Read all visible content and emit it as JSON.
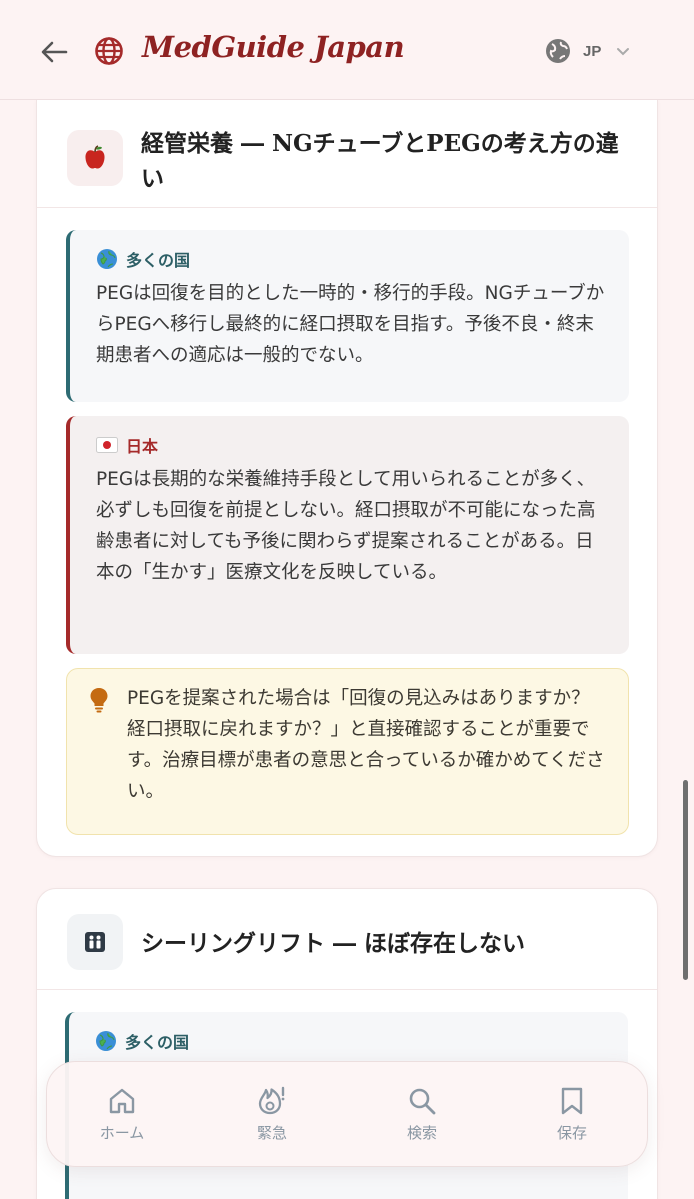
{
  "header": {
    "app_title": "MedGuide Japan",
    "lang_code": "JP"
  },
  "cards": [
    {
      "icon": "apple-icon",
      "title": "経管栄養 ― NGチューブとPEGの考え方の違い",
      "global_label": "多くの国",
      "global_text": "PEGは回復を目的とした一時的・移行的手段。NGチューブからPEGへ移行し最終的に経口摂取を目指す。予後不良・終末期患者への適応は一般的でない。",
      "japan_label": "日本",
      "japan_text": "PEGは長期的な栄養維持手段として用いられることが多く、必ずしも回復を前提としない。経口摂取が不可能になった高齢患者に対しても予後に関わらず提案されることがある。日本の「生かす」医療文化を反映している。",
      "tip_text": "PEGを提案された場合は「回復の見込みはありますか？経口摂取に戻れますか？」と直接確認することが重要です。治療目標が患者の意思と合っているか確かめてください。"
    },
    {
      "icon": "elevator-icon",
      "title": "シーリングリフト ― ほぼ存在しない",
      "global_label": "多くの国"
    }
  ],
  "nav": {
    "items": [
      {
        "label": "ホーム",
        "icon": "home-icon"
      },
      {
        "label": "緊急",
        "icon": "emergency-icon"
      },
      {
        "label": "検索",
        "icon": "search-icon"
      },
      {
        "label": "保存",
        "icon": "bookmark-icon"
      }
    ]
  },
  "colors": {
    "brand": "#8e2222",
    "global_accent": "#2d6b73",
    "japan_accent": "#a52a2a",
    "tip_bg": "#fdf8e4"
  }
}
